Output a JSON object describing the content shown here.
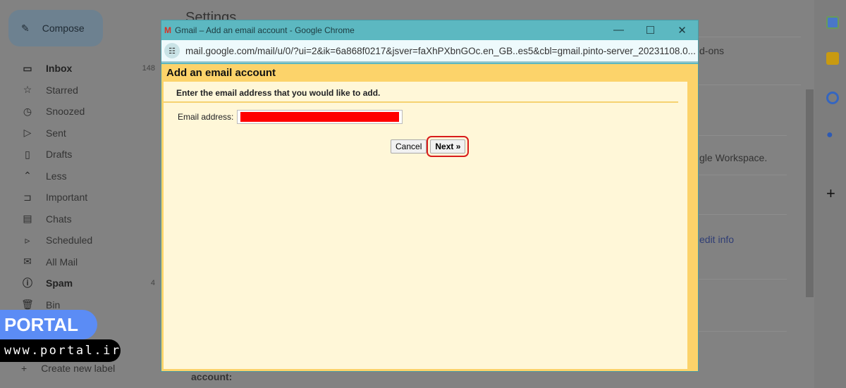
{
  "sidebar": {
    "compose": "Compose",
    "items": [
      {
        "icon": "inbox-icon",
        "glyph": "▭",
        "label": "Inbox",
        "count": "148",
        "bold": true
      },
      {
        "icon": "star-icon",
        "glyph": "☆",
        "label": "Starred"
      },
      {
        "icon": "clock-icon",
        "glyph": "◷",
        "label": "Snoozed"
      },
      {
        "icon": "send-icon",
        "glyph": "▷",
        "label": "Sent"
      },
      {
        "icon": "draft-icon",
        "glyph": "▯",
        "label": "Drafts"
      },
      {
        "icon": "chevron-up-icon",
        "glyph": "⌃",
        "label": "Less"
      },
      {
        "icon": "important-icon",
        "glyph": "⊐",
        "label": "Important"
      },
      {
        "icon": "chat-icon",
        "glyph": "▤",
        "label": "Chats"
      },
      {
        "icon": "scheduled-icon",
        "glyph": "▹",
        "label": "Scheduled"
      },
      {
        "icon": "all-mail-icon",
        "glyph": "✉",
        "label": "All Mail"
      },
      {
        "icon": "spam-icon",
        "glyph": "ⓘ",
        "label": "Spam",
        "count": "4",
        "bold": true
      },
      {
        "icon": "bin-icon",
        "glyph": "🗑",
        "label": "Bin"
      }
    ],
    "create_label": "Create new label"
  },
  "background": {
    "title": "Settings",
    "addons": "d-ons",
    "workspace": "gle Workspace.",
    "edit_info": "edit info",
    "account": "account:"
  },
  "watermark": {
    "brand": "PORTAL",
    "url": "www.portal.ir"
  },
  "popup": {
    "window_title": "Gmail – Add an email account - Google Chrome",
    "url": "mail.google.com/mail/u/0/?ui=2&ik=6a868f0217&jsver=faXhPXbnGOc.en_GB..es5&cbl=gmail.pinto-server_20231108.0...",
    "heading": "Add an email account",
    "instruction": "Enter the email address that you would like to add.",
    "email_label": "Email address:",
    "email_value_redacted_color": "#ff0000",
    "cancel": "Cancel",
    "next": "Next »"
  },
  "colors": {
    "titlebar": "#5cb8c1",
    "header": "#fcd36a",
    "panel": "#fff7d8",
    "highlight": "#d81b1b"
  }
}
